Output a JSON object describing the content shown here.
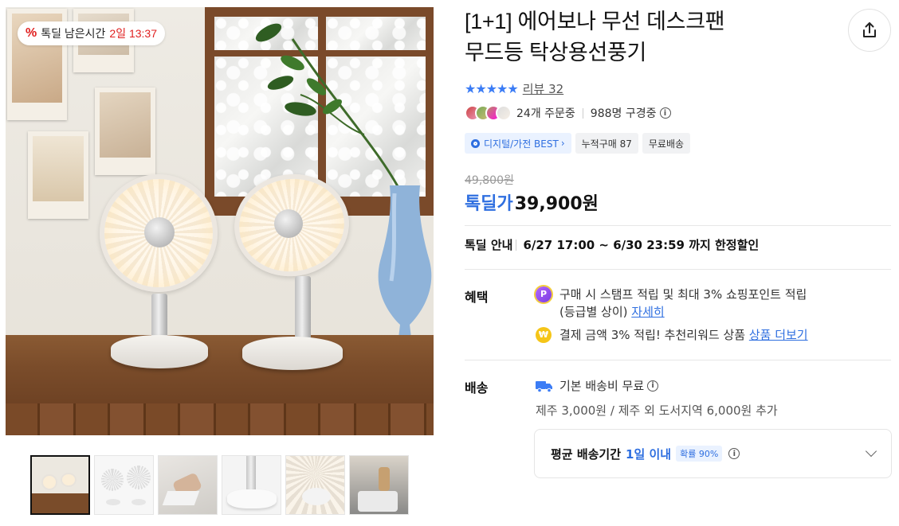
{
  "timer": {
    "prefix": "톡딜 남은시간",
    "remaining": "2일 13:37"
  },
  "product": {
    "title_line1": "[1+1] 에어보나 무선 데스크팬",
    "title_line2": "무드등 탁상용선풍기"
  },
  "rating": {
    "stars": "★★★★★",
    "review_label": "리뷰 32"
  },
  "social": {
    "orders": "24개 주문중",
    "watching": "988명 구경중"
  },
  "tags": {
    "best": "디지털/가전 BEST",
    "cumulative": "누적구매 87",
    "shipping": "무료배송"
  },
  "price": {
    "original": "49,800원",
    "sale_label": "톡딜가",
    "sale_price": "39,900원"
  },
  "deal": {
    "label": "톡딜 안내",
    "period": "6/27 17:00 ~ 6/30 23:59 까지 한정할인"
  },
  "benefits": {
    "label": "혜택",
    "item1_text": "구매 시 스탬프 적립 및 최대 3% 쇼핑포인트 적립",
    "item1_text2": "(등급별 상이)",
    "item1_link": "자세히",
    "item2_text": "결제 금액 3% 적립! 추천리워드 상품",
    "item2_link": "상품 더보기"
  },
  "shipping": {
    "label": "배송",
    "fee": "기본 배송비 무료",
    "extra": "제주 3,000원 / 제주 외 도서지역 6,000원 추가",
    "avg_label": "평균 배송기간",
    "avg_value": "1일 이내",
    "probability": "확률 90%"
  },
  "icons": {
    "share": "share-icon",
    "info": "info-icon",
    "truck": "truck-icon",
    "chevron": "chevron-down-icon",
    "point_coin": "point-coin-icon",
    "won_coin": "won-coin-icon"
  },
  "colors": {
    "accent": "#2f6fe0",
    "timer_red": "#e02020"
  }
}
